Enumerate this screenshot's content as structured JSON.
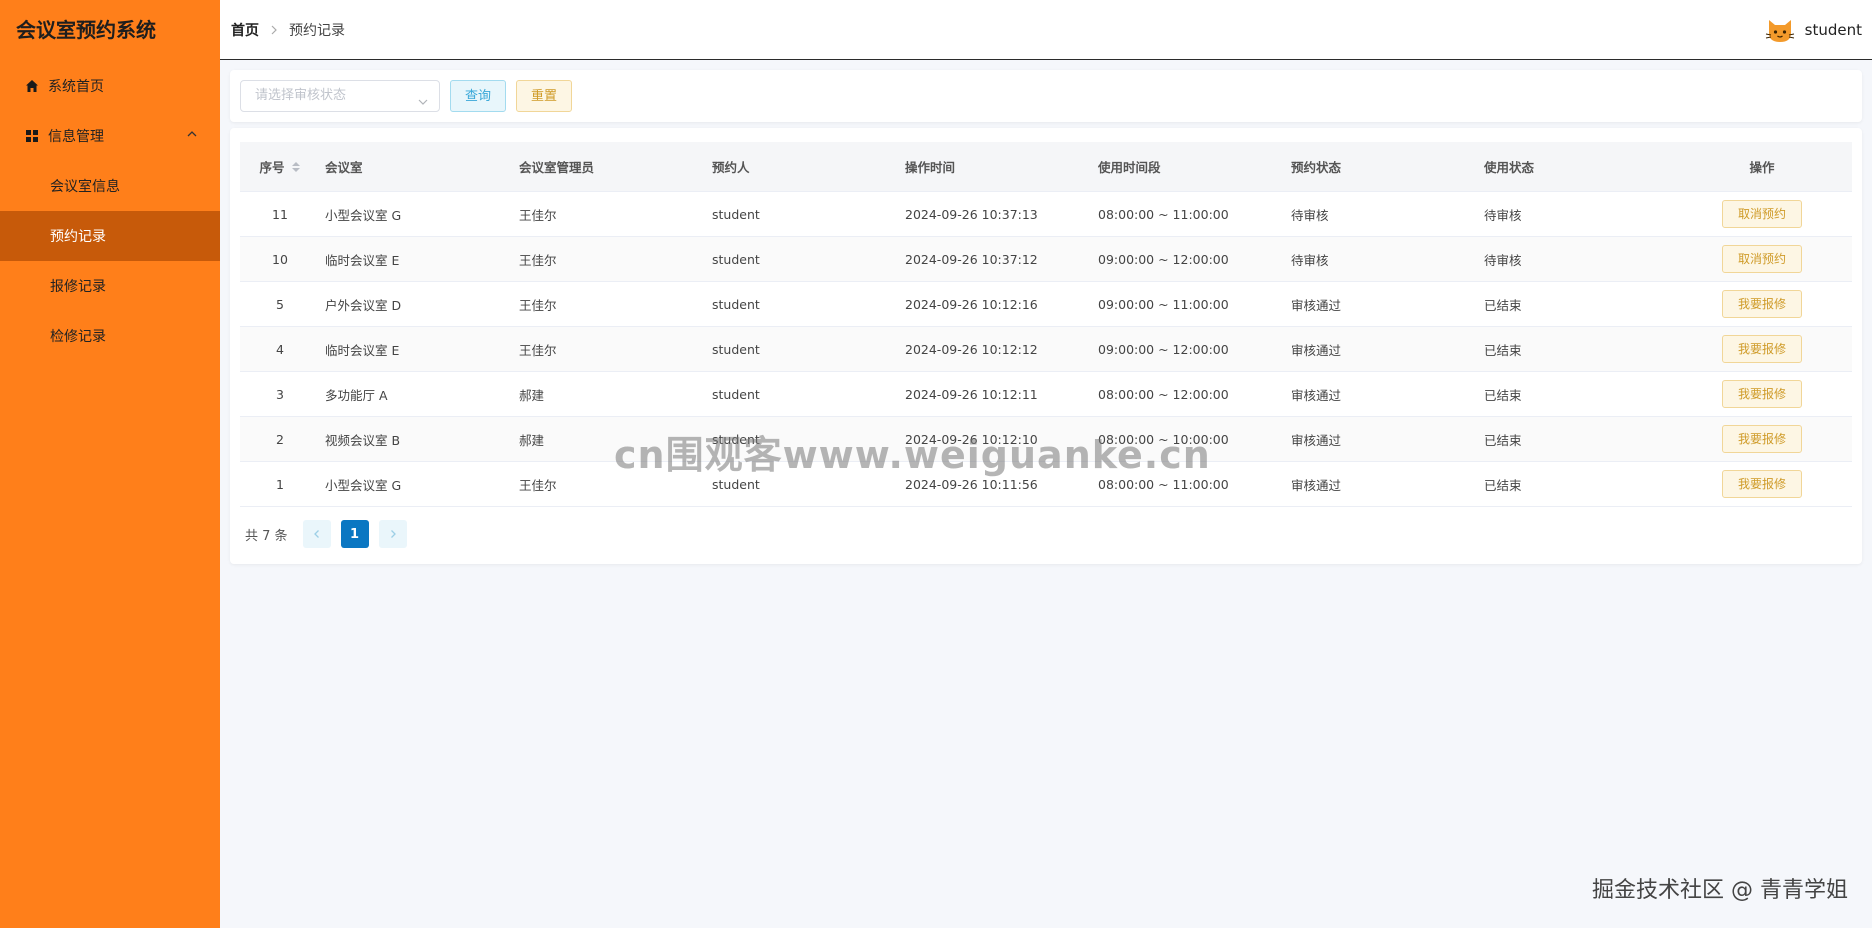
{
  "app": {
    "title": "会议室预约系统"
  },
  "colors": {
    "sidebar": "#ff7f1a",
    "active_item": "#c75a0a",
    "primary": "#0b77c2",
    "warning": "#cf9b28",
    "info": "#3aa8d8"
  },
  "sidebar": {
    "items": [
      {
        "label": "系统首页",
        "icon": "home-icon"
      },
      {
        "label": "信息管理",
        "icon": "grid-icon",
        "expanded": true
      }
    ],
    "sub_items": [
      {
        "label": "会议室信息",
        "active": false
      },
      {
        "label": "预约记录",
        "active": true
      },
      {
        "label": "报修记录",
        "active": false
      },
      {
        "label": "检修记录",
        "active": false
      }
    ]
  },
  "header": {
    "breadcrumb": {
      "home": "首页",
      "current": "预约记录"
    },
    "user": {
      "name": "student",
      "avatar_icon": "cat-avatar-icon"
    }
  },
  "search": {
    "status_placeholder": "请选择审核状态",
    "query_label": "查询",
    "reset_label": "重置"
  },
  "table": {
    "columns": [
      "序号",
      "会议室",
      "会议室管理员",
      "预约人",
      "操作时间",
      "使用时间段",
      "预约状态",
      "使用状态",
      "操作"
    ],
    "rows": [
      {
        "id": "11",
        "room": "小型会议室 G",
        "admin": "王佳尔",
        "booker": "student",
        "op_time": "2024-09-26 10:37:13",
        "period": "08:00:00 ~ 11:00:00",
        "status": "待审核",
        "use_status": "待审核",
        "action": "取消预约"
      },
      {
        "id": "10",
        "room": "临时会议室 E",
        "admin": "王佳尔",
        "booker": "student",
        "op_time": "2024-09-26 10:37:12",
        "period": "09:00:00 ~ 12:00:00",
        "status": "待审核",
        "use_status": "待审核",
        "action": "取消预约"
      },
      {
        "id": "5",
        "room": "户外会议室 D",
        "admin": "王佳尔",
        "booker": "student",
        "op_time": "2024-09-26 10:12:16",
        "period": "09:00:00 ~ 11:00:00",
        "status": "审核通过",
        "use_status": "已结束",
        "action": "我要报修"
      },
      {
        "id": "4",
        "room": "临时会议室 E",
        "admin": "王佳尔",
        "booker": "student",
        "op_time": "2024-09-26 10:12:12",
        "period": "09:00:00 ~ 12:00:00",
        "status": "审核通过",
        "use_status": "已结束",
        "action": "我要报修"
      },
      {
        "id": "3",
        "room": "多功能厅 A",
        "admin": "郝建",
        "booker": "student",
        "op_time": "2024-09-26 10:12:11",
        "period": "08:00:00 ~ 12:00:00",
        "status": "审核通过",
        "use_status": "已结束",
        "action": "我要报修"
      },
      {
        "id": "2",
        "room": "视频会议室 B",
        "admin": "郝建",
        "booker": "student",
        "op_time": "2024-09-26 10:12:10",
        "period": "08:00:00 ~ 10:00:00",
        "status": "审核通过",
        "use_status": "已结束",
        "action": "我要报修"
      },
      {
        "id": "1",
        "room": "小型会议室 G",
        "admin": "王佳尔",
        "booker": "student",
        "op_time": "2024-09-26 10:11:56",
        "period": "08:00:00 ~ 11:00:00",
        "status": "审核通过",
        "use_status": "已结束",
        "action": "我要报修"
      }
    ]
  },
  "pagination": {
    "total_text": "共 7 条",
    "current_page": "1"
  },
  "watermarks": {
    "center": "cn围观客www.weiguanke.cn",
    "corner": "掘金技术社区 @ 青青学姐"
  }
}
